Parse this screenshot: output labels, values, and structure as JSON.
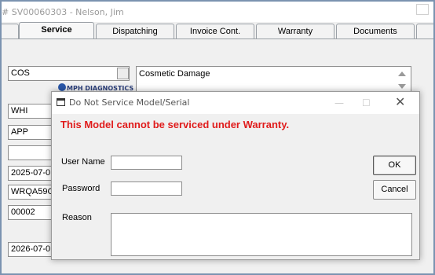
{
  "window": {
    "title": "# SV00060303  -  Nelson, Jim"
  },
  "tabs": [
    {
      "label": "Service",
      "active": true
    },
    {
      "label": "Dispatching",
      "active": false
    },
    {
      "label": "Invoice Cont.",
      "active": false
    },
    {
      "label": "Warranty",
      "active": false
    },
    {
      "label": "Documents",
      "active": false
    }
  ],
  "form": {
    "cos": "COS",
    "cosmetic": "Cosmetic Damage",
    "whi": "WHI",
    "app": "APP",
    "blank": "",
    "date1": "2025-07-0",
    "wrqa": "WRQA59C",
    "num": "00002",
    "date2": "2026-07-0",
    "logo_text": "MPH DIAGNOSTICS"
  },
  "dialog": {
    "title": "Do Not Service Model/Serial",
    "message": "This Model cannot be serviced under Warranty.",
    "username_label": "User Name",
    "password_label": "Password",
    "reason_label": "Reason",
    "username_value": "",
    "password_value": "",
    "reason_value": "",
    "ok_label": "OK",
    "cancel_label": "Cancel",
    "minimize_glyph": "—",
    "maximize_glyph": "☐",
    "close_glyph": "✕"
  },
  "colors": {
    "message": "#e01b1b",
    "frame": "#7b93b0"
  }
}
